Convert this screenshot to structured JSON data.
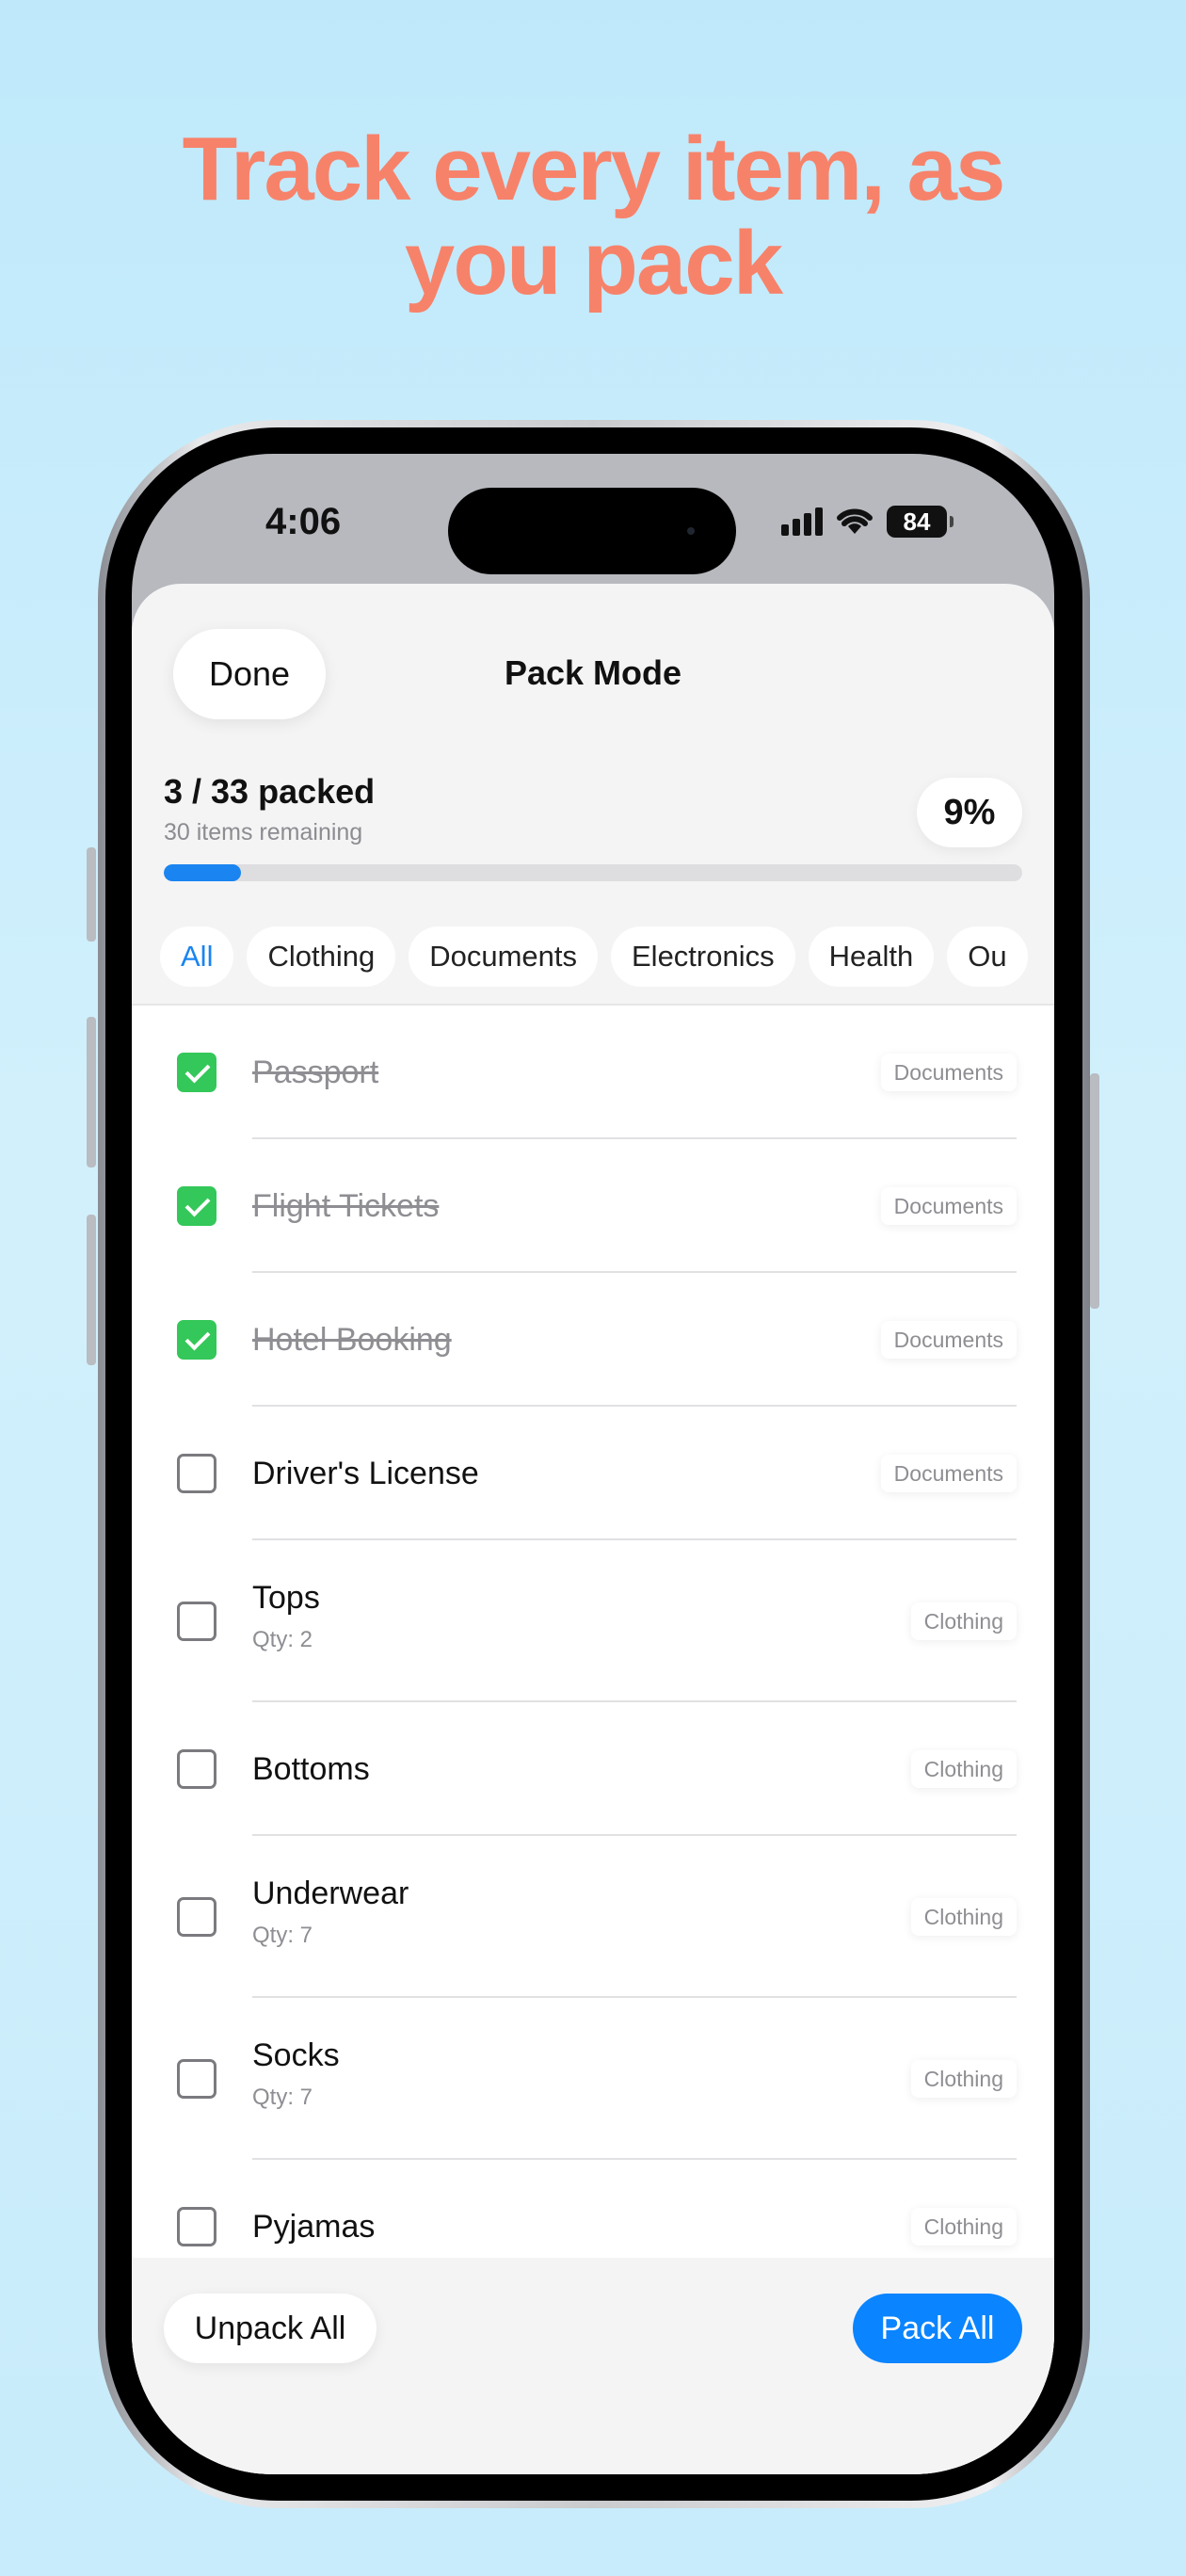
{
  "headline": {
    "line1": "Track every item, as",
    "line2": "you pack"
  },
  "status": {
    "time": "4:06",
    "battery": "84"
  },
  "header": {
    "done_label": "Done",
    "title": "Pack Mode"
  },
  "progress": {
    "packed_text": "3 / 33 packed",
    "remaining_text": "30 items remaining",
    "percent_text": "9%",
    "fraction": 0.09
  },
  "filters": [
    "All",
    "Clothing",
    "Documents",
    "Electronics",
    "Health",
    "Ou"
  ],
  "active_filter": "All",
  "items": [
    {
      "name": "Passport",
      "qty": "",
      "category": "Documents",
      "packed": true
    },
    {
      "name": "Flight Tickets",
      "qty": "",
      "category": "Documents",
      "packed": true
    },
    {
      "name": "Hotel Booking",
      "qty": "",
      "category": "Documents",
      "packed": true
    },
    {
      "name": "Driver's License",
      "qty": "",
      "category": "Documents",
      "packed": false
    },
    {
      "name": "Tops",
      "qty": "Qty: 2",
      "category": "Clothing",
      "packed": false
    },
    {
      "name": "Bottoms",
      "qty": "",
      "category": "Clothing",
      "packed": false
    },
    {
      "name": "Underwear",
      "qty": "Qty: 7",
      "category": "Clothing",
      "packed": false
    },
    {
      "name": "Socks",
      "qty": "Qty: 7",
      "category": "Clothing",
      "packed": false
    },
    {
      "name": "Pyjamas",
      "qty": "",
      "category": "Clothing",
      "packed": false
    }
  ],
  "footer": {
    "unpack_label": "Unpack All",
    "pack_label": "Pack All"
  },
  "colors": {
    "headline": "#f7826a",
    "accent": "#0a84ff",
    "check": "#34c759"
  }
}
